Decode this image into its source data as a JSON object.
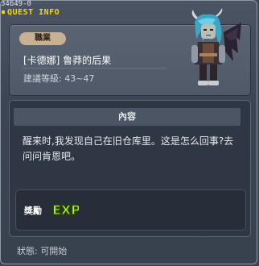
{
  "window": {
    "quest_id": "34649-0",
    "title": "QUEST INFO"
  },
  "quest": {
    "job_label": "職業",
    "name": "[卡德娜] 鲁莽的后果",
    "level_range": "建議等級: 43~47"
  },
  "content": {
    "header": "內容",
    "description": "醒来时,我发现自己在旧仓库里。这是怎么回事?去问问肯恩吧。"
  },
  "reward": {
    "label": "獎勵",
    "icon": "exp-icon",
    "icon_text": "EXP"
  },
  "status": {
    "text": "狀態: 可開始"
  },
  "colors": {
    "title": "#f6d600",
    "job_pill": "#c8b092",
    "exp_fill": "#b4ff1e"
  }
}
